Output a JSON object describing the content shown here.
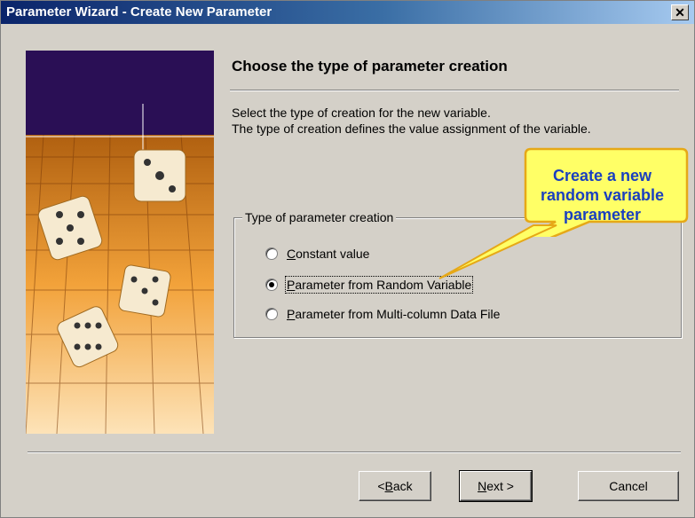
{
  "window": {
    "title": "Parameter Wizard - Create New Parameter",
    "close_label": "✕"
  },
  "page": {
    "heading": "Choose the type of parameter creation",
    "description_line1": "Select the type of creation for the new variable.",
    "description_line2": "The type of creation defines the value assignment of the variable."
  },
  "callout": {
    "line1": "Create a new",
    "line2": "random variable",
    "line3": "parameter",
    "color": "#1a3fbf",
    "fill": "#ffff66",
    "border": "#e6a817"
  },
  "group": {
    "label": "Type of parameter creation",
    "options": [
      {
        "mnemonic": "C",
        "rest": "onstant value",
        "checked": false
      },
      {
        "mnemonic": "P",
        "rest": "arameter from Random Variable",
        "checked": true
      },
      {
        "mnemonic": "P",
        "rest": "arameter from Multi-column Data File",
        "checked": false
      }
    ]
  },
  "buttons": {
    "back_prefix": "< ",
    "back_mnemonic": "B",
    "back_rest": "ack",
    "next_mnemonic": "N",
    "next_rest": "ext >",
    "cancel": "Cancel"
  },
  "banner": {
    "icon": "dice-illustration",
    "top_color": "#2a0f55",
    "accent_color": "#f0a030"
  }
}
